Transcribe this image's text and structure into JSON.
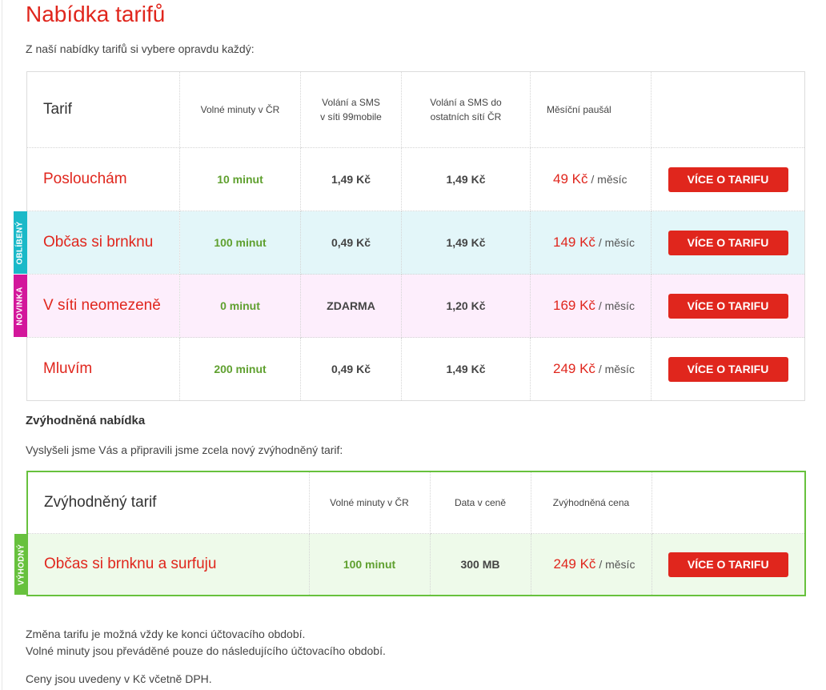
{
  "page": {
    "title": "Nabídka tarifů",
    "intro": "Z naší nabídky tarifů si vybere opravdu každý:"
  },
  "tariffs": {
    "headers": {
      "tarif": "Tarif",
      "minutes": "Volné minuty v ČR",
      "calls_99_line1": "Volání a SMS",
      "calls_99_line2": "v síti 99mobile",
      "calls_other_line1": "Volání a SMS do",
      "calls_other_line2": "ostatních sítí ČR",
      "monthly": "Měsíční paušál"
    },
    "rows": [
      {
        "name": "Poslouchám",
        "minutes": "10 minut",
        "calls_99": "1,49 Kč",
        "calls_other": "1,49 Kč",
        "price": "49 Kč",
        "unit": "/ měsíc",
        "button": "VÍCE O TARIFU",
        "tag": ""
      },
      {
        "name": "Občas si brnknu",
        "minutes": "100 minut",
        "calls_99": "0,49 Kč",
        "calls_other": "1,49 Kč",
        "price": "149 Kč",
        "unit": "/ měsíc",
        "button": "VÍCE O TARIFU",
        "tag": "OBLÍBENÝ"
      },
      {
        "name": "V síti neomezeně",
        "minutes": "0 minut",
        "calls_99": "ZDARMA",
        "calls_other": "1,20 Kč",
        "price": "169 Kč",
        "unit": "/ měsíc",
        "button": "VÍCE O TARIFU",
        "tag": "NOVINKA"
      },
      {
        "name": "Mluvím",
        "minutes": "200 minut",
        "calls_99": "0,49 Kč",
        "calls_other": "1,49 Kč",
        "price": "249 Kč",
        "unit": "/ měsíc",
        "button": "VÍCE O TARIFU",
        "tag": ""
      }
    ]
  },
  "special": {
    "title": "Zvýhodněná nabídka",
    "intro": "Vyslyšeli jsme Vás a připravili jsme zcela nový zvýhodněný tarif:",
    "headers": {
      "tarif": "Zvýhodněný tarif",
      "minutes": "Volné minuty v ČR",
      "data": "Data v ceně",
      "price": "Zvýhodněná cena"
    },
    "row": {
      "name": "Občas si brnknu a surfuju",
      "minutes": "100 minut",
      "data": "300 MB",
      "price": "249 Kč",
      "unit": "/ měsíc",
      "button": "VÍCE O TARIFU",
      "tag": "VÝHODNÝ"
    }
  },
  "notes": {
    "line1": "Změna tarifu je možná vždy ke konci účtovacího období.",
    "line2": "Volné minuty jsou převáděné pouze do následujícího účtovacího období.",
    "line3": "Ceny jsou uvedeny v Kč včetně DPH."
  },
  "colors": {
    "brand_red": "#e0261d",
    "minutes_green": "#5fa02f",
    "tag_cyan": "#1ab9c8",
    "tag_magenta": "#d3179b",
    "tag_green": "#67c13d"
  }
}
